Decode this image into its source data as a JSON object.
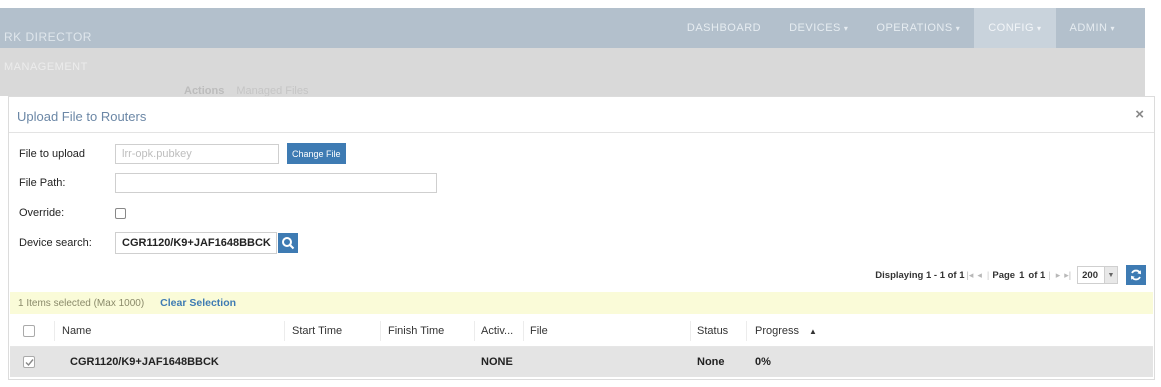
{
  "app": {
    "title": "RK DIRECTOR",
    "nav": [
      {
        "label": "DASHBOARD",
        "caret": ""
      },
      {
        "label": "DEVICES",
        "caret": "▾"
      },
      {
        "label": "OPERATIONS",
        "caret": "▾"
      },
      {
        "label": "CONFIG",
        "caret": "▾"
      },
      {
        "label": "ADMIN",
        "caret": "▾"
      }
    ],
    "section": "MANAGEMENT",
    "tabs": [
      "Actions",
      "Managed Files"
    ]
  },
  "dialog": {
    "title": "Upload File to Routers",
    "close_glyph": "×",
    "file_label": "File to upload",
    "file_value": "lrr-opk.pubkey",
    "change_file": "Change File",
    "path_label": "File Path:",
    "path_value": "",
    "override_label": "Override:",
    "override_checked": false,
    "device_label": "Device search:",
    "device_value": "CGR1120/K9+JAF1648BBCK"
  },
  "pager": {
    "displaying": "Displaying 1 - 1 of 1",
    "page_label": "Page",
    "page_value": "1",
    "of_label": "of 1",
    "page_size": "200"
  },
  "selection": {
    "count_text": "1 Items selected (Max 1000)",
    "clear_label": "Clear Selection"
  },
  "grid": {
    "columns": [
      "Name",
      "Start Time",
      "Finish Time",
      "Activ...",
      "File",
      "Status",
      "Progress"
    ],
    "sort_glyph": "▲",
    "rows": [
      {
        "checked": true,
        "name": "CGR1120/K9+JAF1648BBCK",
        "start": "",
        "finish": "",
        "activity": "NONE",
        "file": "",
        "status": "None",
        "progress": "0%"
      }
    ]
  },
  "colors": {
    "accent": "#3e7bb3",
    "title_blue": "#6b87a6",
    "selection_bar": "#fafbd8",
    "row_selected": "#e4e4e4",
    "nav_bg": "#b3c0cc"
  },
  "icons": {
    "search": "search-icon",
    "refresh": "refresh-icon",
    "close": "close-icon",
    "first": "first-page-icon",
    "prev": "prev-page-icon",
    "next": "next-page-icon",
    "last": "last-page-icon"
  }
}
